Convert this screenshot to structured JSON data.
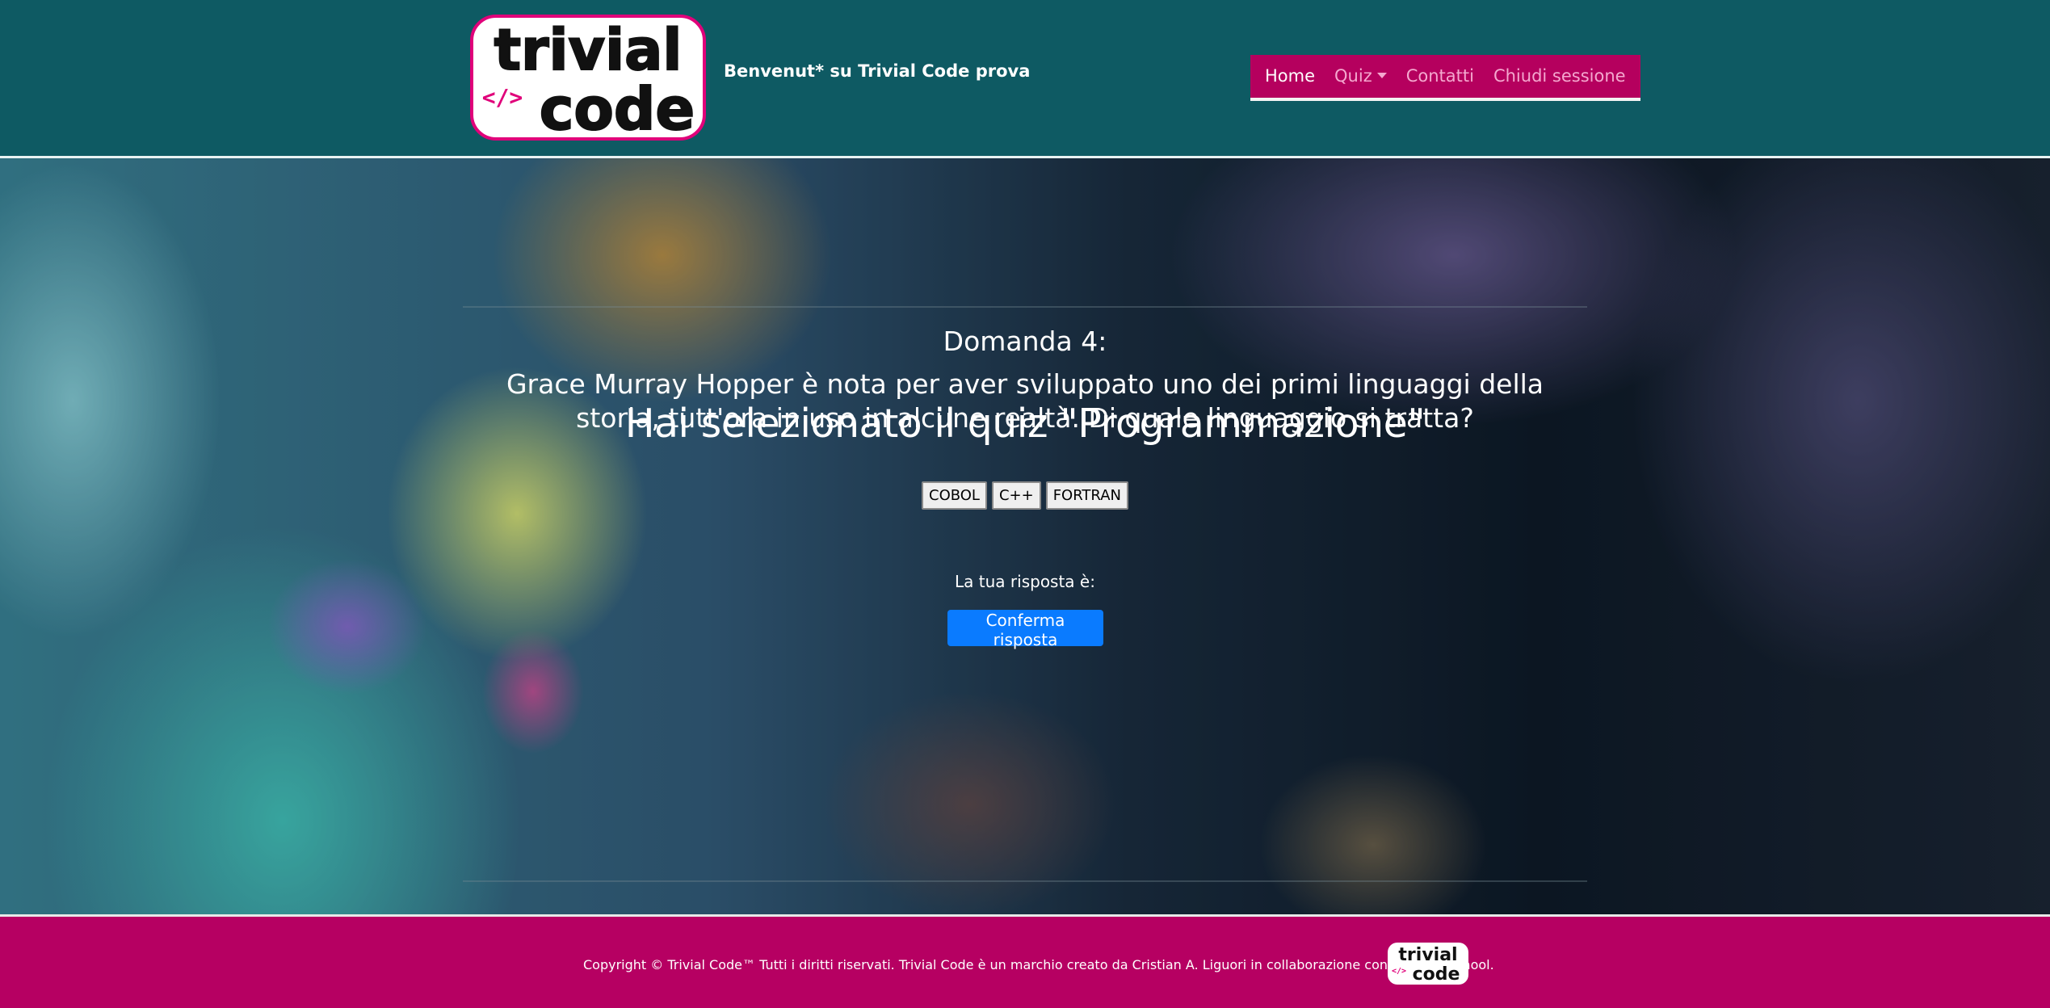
{
  "header": {
    "logo": {
      "line1": "trivial",
      "line2": "code",
      "symbol": "</>"
    },
    "welcome": "Benvenut* su Trivial Code prova"
  },
  "nav": {
    "items": [
      {
        "label": "Home",
        "active": true
      },
      {
        "label": "Quiz",
        "dropdown": true
      },
      {
        "label": "Contatti"
      },
      {
        "label": "Chiudi sessione"
      }
    ]
  },
  "main": {
    "title": "Hai selezionato il quiz \"Programmazione\"",
    "question_number": "Domanda 4:",
    "question_text": "Grace Murray Hopper è nota per aver sviluppato uno dei primi linguaggi della storia, tutt'ora in uso in alcune realtà. Di quale linguaggio si tratta?",
    "answers": [
      "COBOL",
      "C++",
      "FORTRAN"
    ],
    "your_answer_label": "La tua risposta è:",
    "confirm_label": "Conferma risposta"
  },
  "footer": {
    "copyright": "Copyright © Trivial Code™ Tutti i diritti riservati. Trivial Code è un marchio creato da Cristian A. Liguori in collaborazione con Epicode School."
  },
  "colors": {
    "header_bg": "#0e5a63",
    "nav_bg": "#b5005e",
    "footer_bg": "#b60062",
    "primary_button": "#0a7bff"
  }
}
